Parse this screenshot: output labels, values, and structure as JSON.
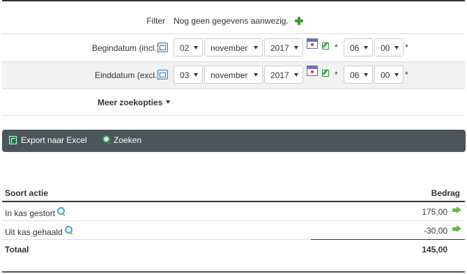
{
  "filter": {
    "label": "Filter",
    "value": "Nog geen gegevens aanwezig."
  },
  "begin": {
    "label": "Begindatum (incl.)",
    "day": "02",
    "month": "november",
    "year": "2017",
    "hour": "06",
    "minute": "00",
    "required_marker": "*"
  },
  "end": {
    "label": "Einddatum (excl.)",
    "day": "03",
    "month": "november",
    "year": "2017",
    "hour": "06",
    "minute": "00",
    "required_marker": "*"
  },
  "more": {
    "label": "Meer zoekopties"
  },
  "toolbar": {
    "export_label": "Export naar Excel",
    "search_label": "Zoeken"
  },
  "table": {
    "headers": {
      "type": "Soort actie",
      "amount": "Bedrag"
    },
    "rows": [
      {
        "type": "In kas gestort",
        "amount": "175,00"
      },
      {
        "type": "Uit kas gehaald",
        "amount": "-30,00"
      }
    ],
    "total": {
      "label": "Totaal",
      "amount": "145,00"
    }
  },
  "colors": {
    "toolbar_bg": "#4c565a",
    "accent_green": "#3c9a2e"
  },
  "icons": [
    "plus-icon",
    "calendar-info-icon",
    "calendar-picker-icon",
    "edit-icon",
    "excel-icon",
    "search-icon",
    "magnifier-icon",
    "arrow-right-icon",
    "caret-down-icon"
  ]
}
